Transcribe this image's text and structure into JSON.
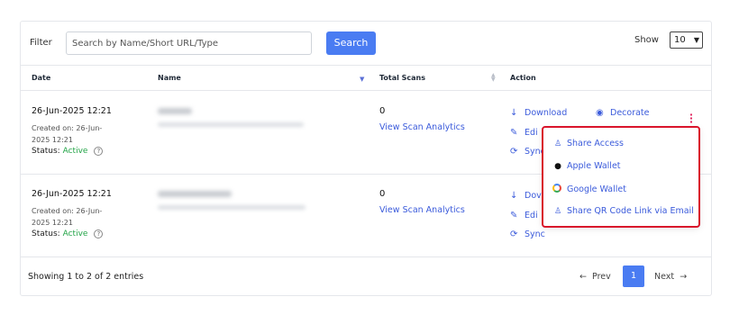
{
  "filter": {
    "label": "Filter",
    "search_placeholder": "Search by Name/Short URL/Type",
    "search_button": "Search",
    "show_label": "Show",
    "show_value": "10"
  },
  "table": {
    "headers": {
      "date": "Date",
      "name": "Name",
      "total_scans": "Total Scans",
      "action": "Action"
    },
    "rows": [
      {
        "date": "26-Jun-2025 12:21",
        "created_on": "Created on: 26-Jun-2025 12:21",
        "status_label": "Status:",
        "status_value": "Active",
        "total_scans": "0",
        "analytics_link": "View Scan Analytics"
      },
      {
        "date": "26-Jun-2025 12:21",
        "created_on": "Created on: 26-Jun-2025 12:21",
        "status_label": "Status:",
        "status_value": "Active",
        "total_scans": "0",
        "analytics_link": "View Scan Analytics"
      }
    ],
    "actions": {
      "download": "Download",
      "decorate": "Decorate",
      "edit_partial": "Edi",
      "sync_partial": "Sync",
      "download_partial": "Dov",
      "edit_partial2": "Edi",
      "sync": "Sync"
    }
  },
  "dropdown": {
    "items": [
      {
        "label": "Share Access",
        "icon": "people-icon"
      },
      {
        "label": "Apple Wallet",
        "icon": "apple-icon"
      },
      {
        "label": "Google Wallet",
        "icon": "google-icon"
      },
      {
        "label": "Share QR Code Link via Email",
        "icon": "people-icon"
      }
    ]
  },
  "footer": {
    "info": "Showing 1 to 2 of 2 entries",
    "prev": "Prev",
    "page": "1",
    "next": "Next"
  },
  "colors": {
    "primary": "#4a7cf2",
    "link": "#3b5bdb",
    "active": "#22a447",
    "highlight_border": "#d9142b"
  }
}
